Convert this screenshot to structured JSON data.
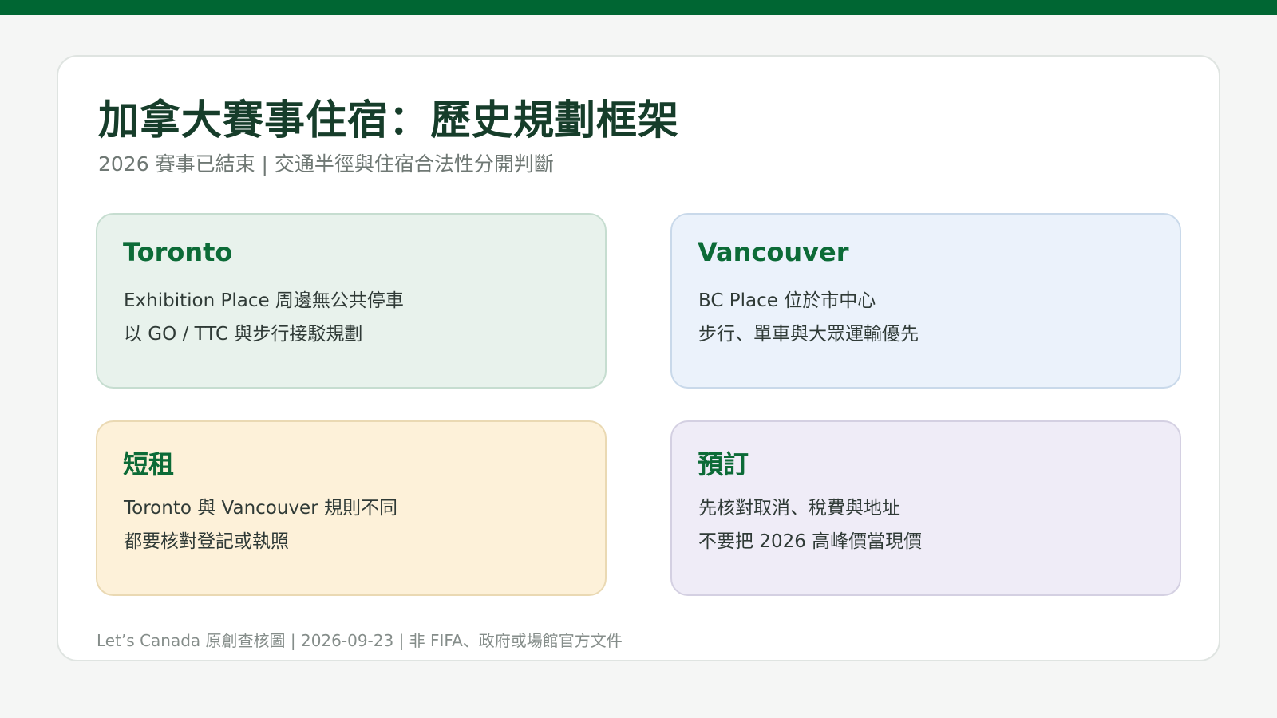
{
  "colors": {
    "accent": "#006633",
    "title": "#163d2a",
    "card_heading": "#0c6b37",
    "card_toronto_bg": "#e8f2ec",
    "card_vancouver_bg": "#ebf2fb",
    "card_rental_bg": "#fdf1d9",
    "card_booking_bg": "#efecf7"
  },
  "slide": {
    "title": "加拿大賽事住宿：歷史規劃框架",
    "subtitle": "2026 賽事已結束 | 交通半徑與住宿合法性分開判斷"
  },
  "cards": [
    {
      "heading": "Toronto",
      "lines": [
        "Exhibition Place 周邊無公共停車",
        "以 GO / TTC 與步行接駁規劃"
      ]
    },
    {
      "heading": "Vancouver",
      "lines": [
        "BC Place 位於市中心",
        "步行、單車與大眾運輸優先"
      ]
    },
    {
      "heading": "短租",
      "lines": [
        "Toronto 與 Vancouver 規則不同",
        "都要核對登記或執照"
      ]
    },
    {
      "heading": "預訂",
      "lines": [
        "先核對取消、稅費與地址",
        "不要把 2026 高峰價當現價"
      ]
    }
  ],
  "footer": "Let’s Canada 原創查核圖 | 2026-09-23 | 非 FIFA、政府或場館官方文件"
}
